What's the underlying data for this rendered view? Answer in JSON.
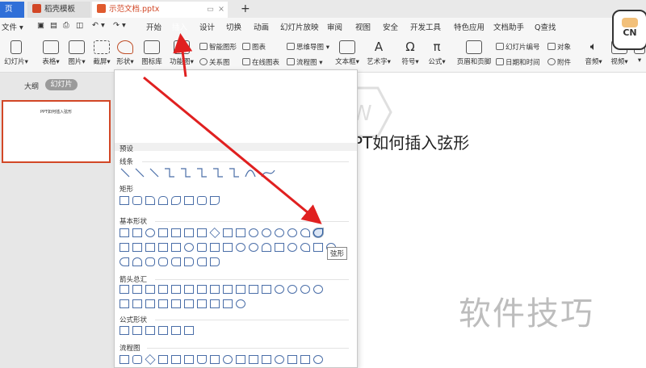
{
  "tabs": [
    {
      "label": "页",
      "active": false
    },
    {
      "label": "稻壳模板",
      "active": false
    },
    {
      "label": "示范文档.pptx",
      "active": true
    },
    {
      "label": "+",
      "active": false
    }
  ],
  "menu": {
    "file": "文件",
    "items": [
      "开始",
      "插入",
      "设计",
      "切换",
      "动画",
      "幻灯片放映",
      "审阅",
      "视图",
      "安全",
      "开发工具",
      "特色应用",
      "文档助手"
    ],
    "search": "Q查找"
  },
  "ribbon": {
    "new_slide": "幻灯片",
    "table": "表格",
    "picture": "图片",
    "screenshot": "截屏",
    "shape": "形状",
    "gallery": "图标库",
    "function_chart": "功能图",
    "smart_shape": "智能图形",
    "relation": "关系图",
    "chart": "图表",
    "online_chart": "在线图表",
    "mindmap": "思维导图",
    "flowchart": "流程图",
    "textbox": "文本框",
    "art": "艺术字",
    "symbol": "符号",
    "formula": "公式",
    "header_footer": "页眉和页脚",
    "slide_num": "幻灯片编号",
    "datetime": "日期和时间",
    "object": "对象",
    "attachment": "附件",
    "audio": "音频",
    "video": "视频"
  },
  "leftpane": {
    "outline": "大纲",
    "slides": "幻灯片",
    "thumb_text": "PPT如何插入弦形"
  },
  "slide": {
    "title_visible": "PT如何插入弦形",
    "watermark": "软件技巧"
  },
  "dropdown": {
    "preset": "预设",
    "lines": "线条",
    "rect": "矩形",
    "basic": "基本形状",
    "arrows": "箭头总汇",
    "formula": "公式形状",
    "flow": "流程图",
    "tooltip": "弦形"
  },
  "badge": "CN",
  "colors": {
    "accent": "#d24726",
    "arrow": "#e02020",
    "shape": "#4a6ea8"
  }
}
